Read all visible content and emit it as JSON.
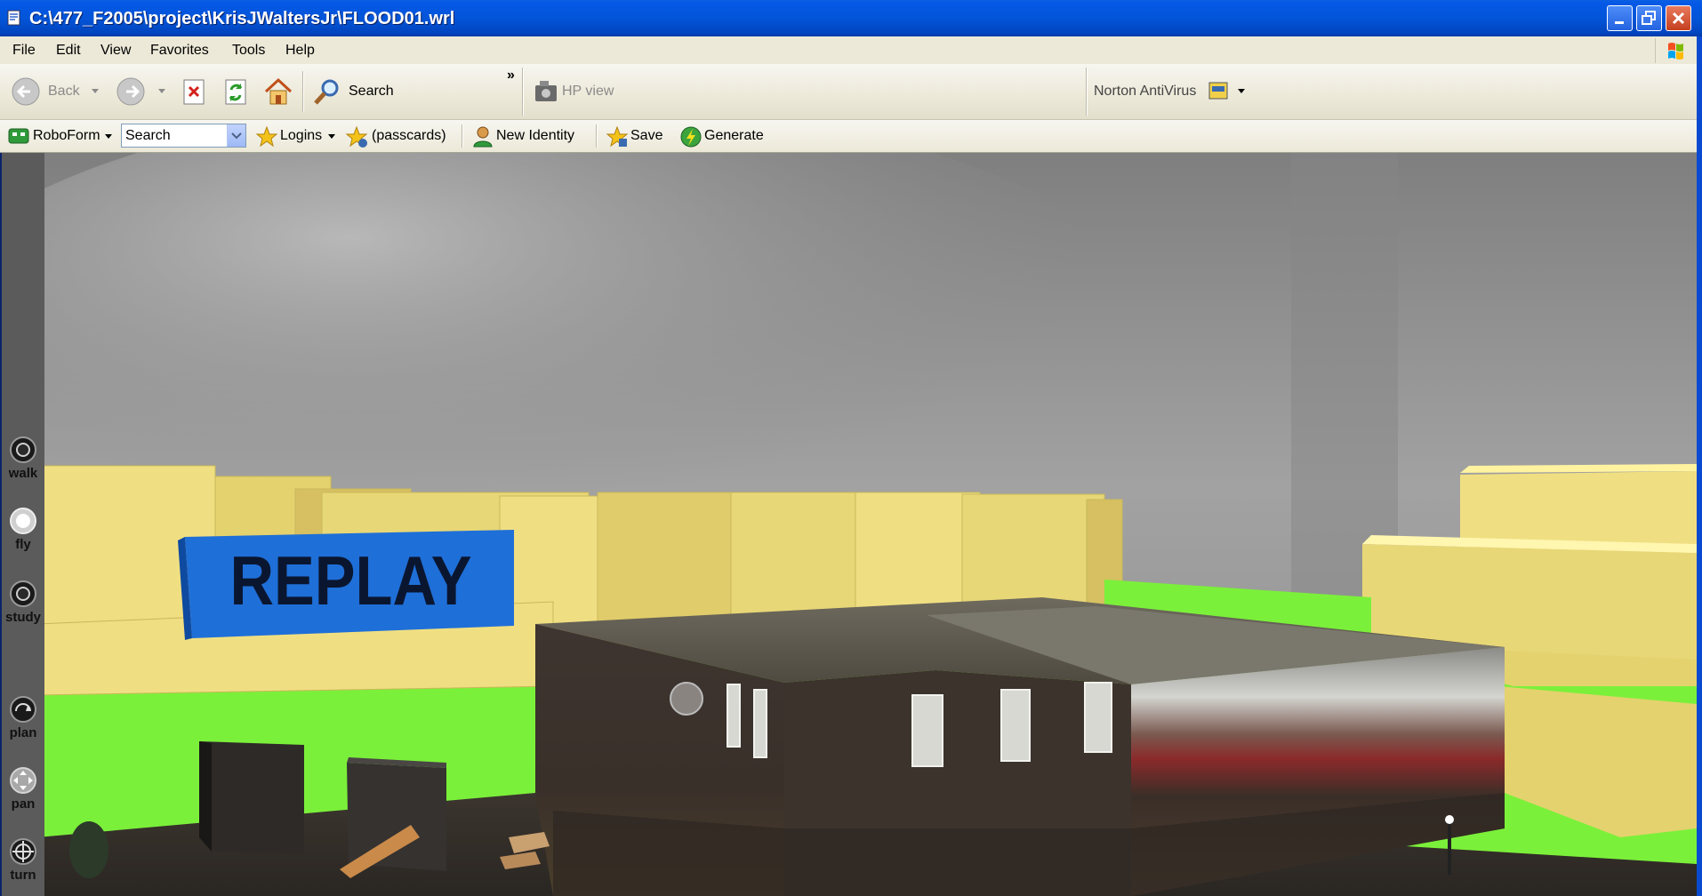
{
  "window": {
    "title": "C:\\477_F2005\\project\\KrisJWaltersJr\\FLOOD01.wrl",
    "controls": [
      "minimize",
      "restore",
      "close"
    ]
  },
  "menu": [
    "File",
    "Edit",
    "View",
    "Favorites",
    "Tools",
    "Help"
  ],
  "toolbar": {
    "back_label": "Back",
    "search_label": "Search",
    "chevron": "»",
    "hp_view_label": "HP view",
    "norton_label": "Norton AntiVirus"
  },
  "roboform": {
    "roboform_label": "RoboForm",
    "search_value": "Search",
    "logins_label": "Logins",
    "passcards_label": "(passcards)",
    "new_identity_label": "New Identity",
    "save_label": "Save",
    "generate_label": "Generate"
  },
  "scene": {
    "replay_label": "REPLAY",
    "sky_color": "#9a9a9a",
    "grass_color": "#7bf03a",
    "building_color": "#e8d777"
  },
  "nav": {
    "walk": "walk",
    "fly": "fly",
    "study": "study",
    "plan": "plan",
    "pan": "pan",
    "turn": "turn"
  }
}
